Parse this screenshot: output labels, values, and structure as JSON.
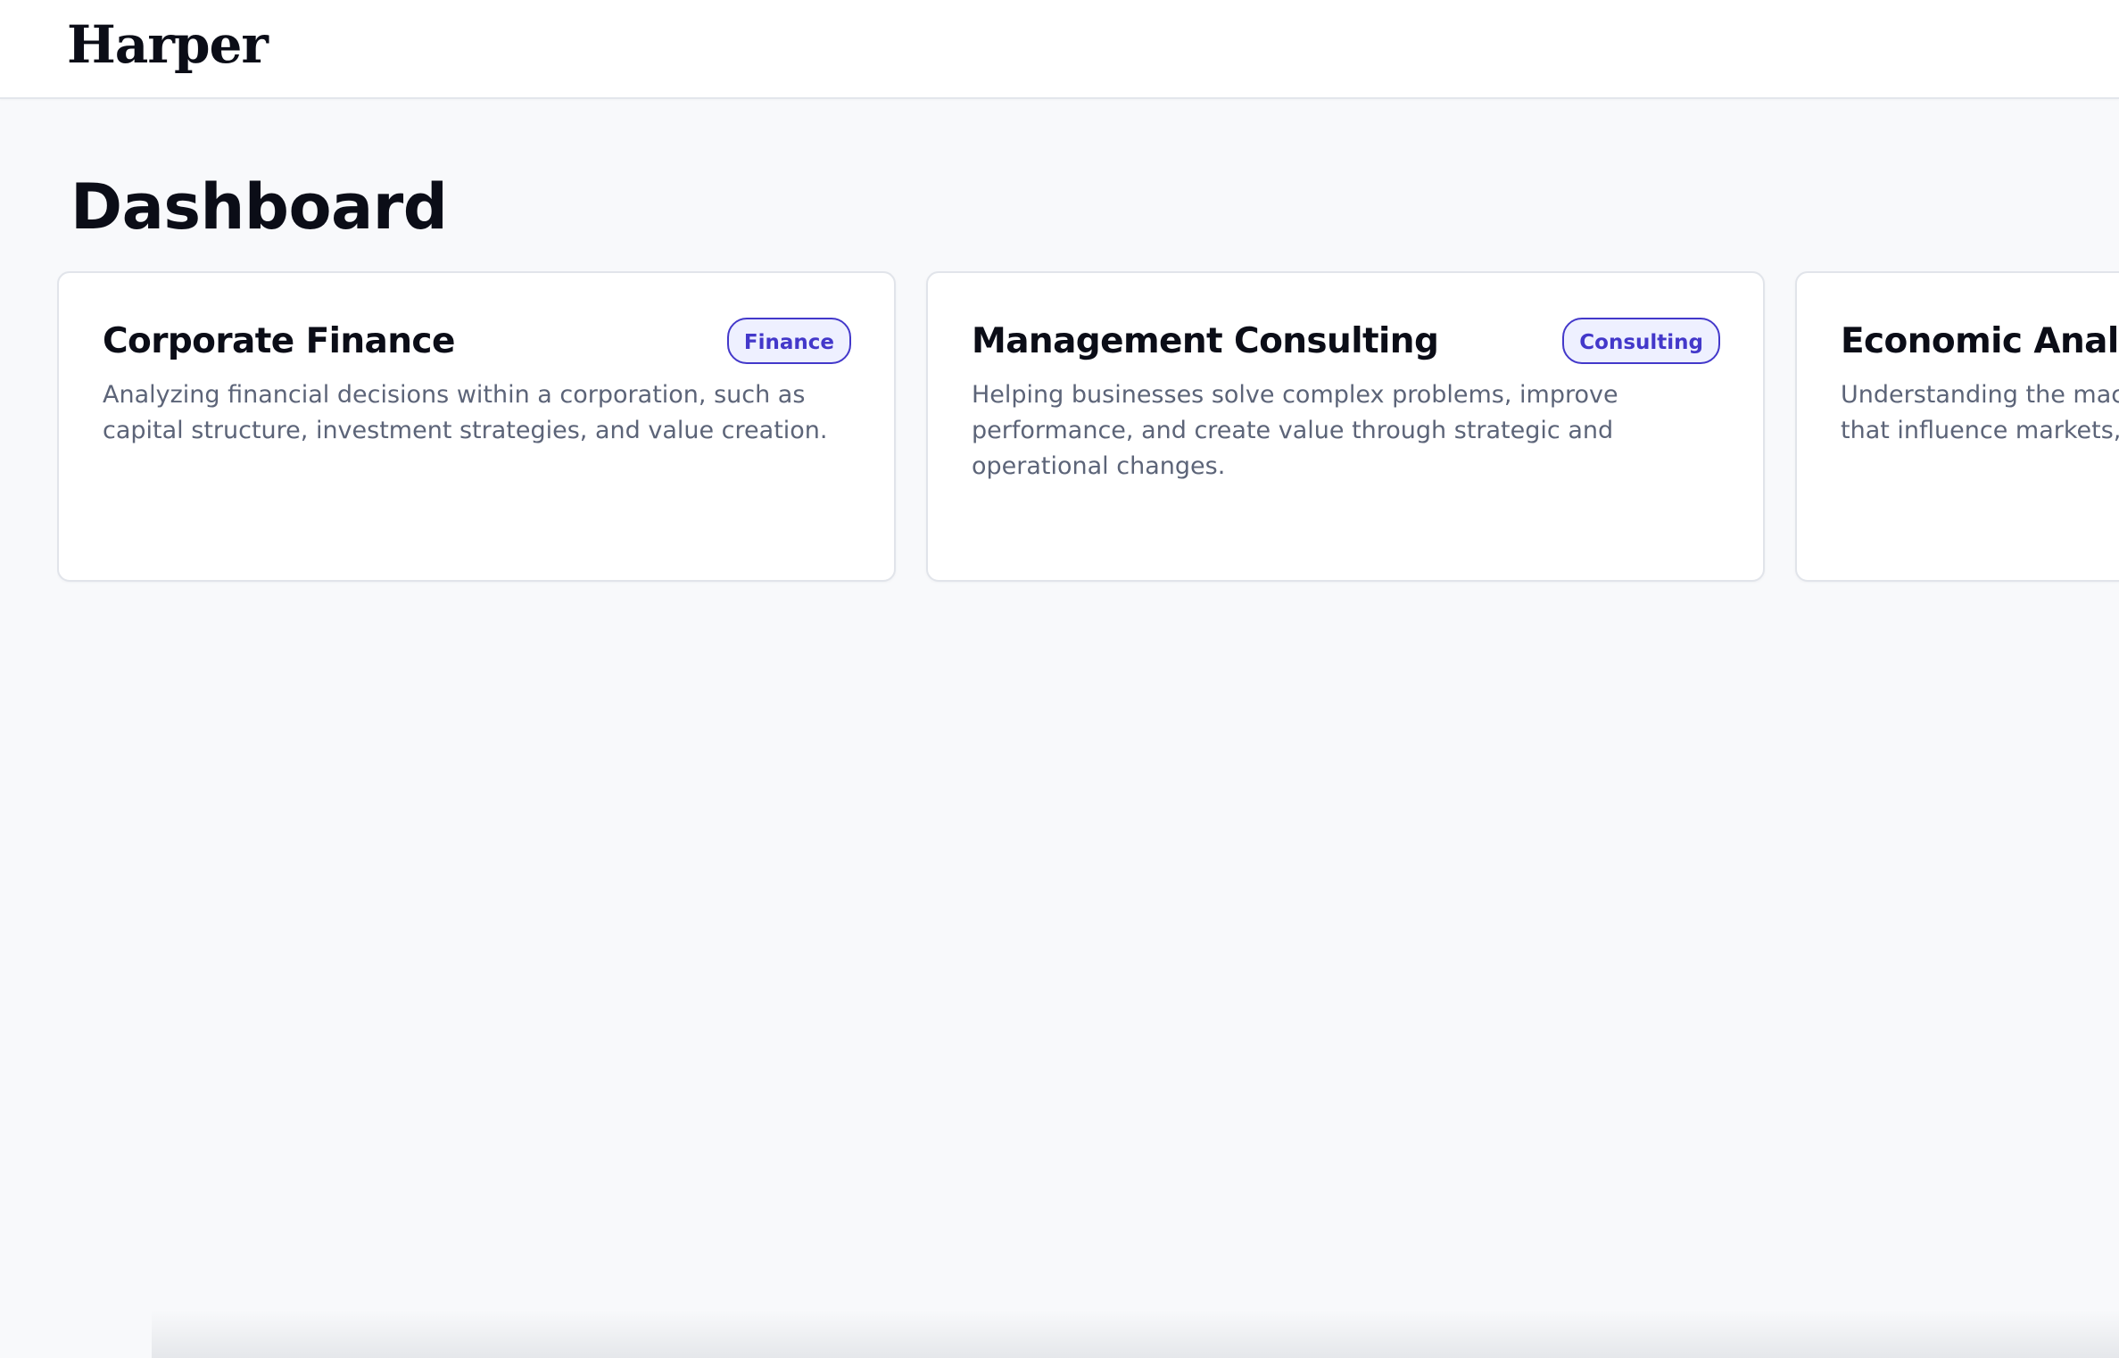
{
  "app": {
    "logo": "Harper"
  },
  "page": {
    "title": "Dashboard"
  },
  "cards": [
    {
      "title": "Corporate Finance",
      "badge": "Finance",
      "description": "Analyzing financial decisions within a corporation, such as capital structure, investment strategies, and value creation."
    },
    {
      "title": "Management Consulting",
      "badge": "Consulting",
      "description": "Helping businesses solve complex problems, improve performance, and create value through strategic and operational changes."
    },
    {
      "title": "Economic Analys",
      "description_line_1": "Understanding the macr",
      "description_line_2": "that influence markets, i"
    }
  ],
  "colors": {
    "accent": "#4338ca",
    "badge_background": "#eef0ff",
    "page_background": "#f8f9fb",
    "card_background": "#ffffff",
    "title_text": "#0b0d17",
    "description_text": "#5c6478"
  }
}
